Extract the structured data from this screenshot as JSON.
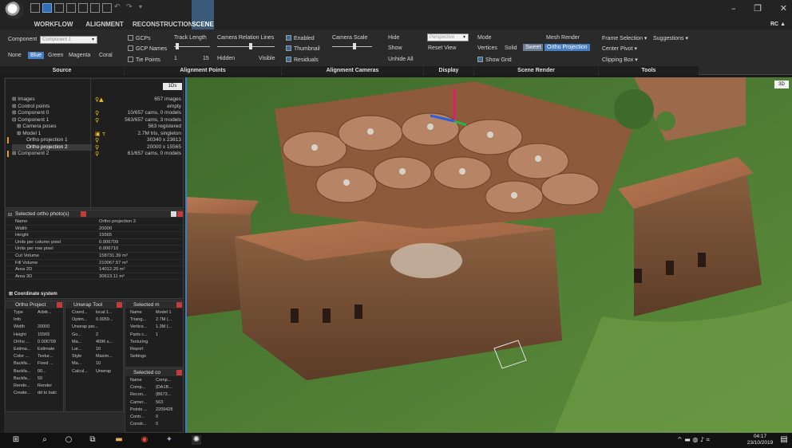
{
  "tabs": [
    "WORKFLOW",
    "ALIGNMENT",
    "RECONSTRUCTION",
    "SCENE"
  ],
  "titlebar": {
    "right_label": "RC"
  },
  "ribbon": {
    "component_label": "Component",
    "component_value": "Component 1",
    "colors": [
      "None",
      "Blue",
      "Green",
      "Magenta",
      "Coral"
    ],
    "gcps": "GCPs",
    "gcp_names": "GCP Names",
    "tie_points": "Tie Points",
    "track_length": "Track Length",
    "track_min": "1",
    "track_max": "15",
    "camera_relation": "Camera Relation Lines",
    "hidden": "Hidden",
    "visible": "Visible",
    "enabled": "Enabled",
    "thumbnail": "Thumbnail",
    "residuals": "Residuals",
    "camera_scale": "Camera Scale",
    "hide": "Hide",
    "show": "Show",
    "unhide_all": "Unhide All",
    "perspective": "Perspective",
    "reset_view": "Reset View",
    "mode": "Mode",
    "vertices": "Vertices",
    "solid": "Solid",
    "sweet": "Sweet",
    "mesh_render": "Mesh Render",
    "ortho_projection": "Ortho Projection",
    "show_grid": "Show Grid",
    "frame_selection": "Frame Selection",
    "suggestions": "Suggestions",
    "center_pivot": "Center Pivot",
    "clipping_box": "Clipping Box",
    "groups": [
      "Source",
      "Alignment Points",
      "Alignment Cameras",
      "Display",
      "Scene Render",
      "Tools"
    ]
  },
  "tree": {
    "badge": "1Ds",
    "rows": [
      {
        "name": "Images",
        "value": "657 images"
      },
      {
        "name": "Control points",
        "value": "empty"
      },
      {
        "name": "Component 0",
        "value": "10/657 cams, 0 models"
      },
      {
        "name": "Component 1",
        "value": "563/657 cams, 3 models"
      },
      {
        "name": "Camera poses",
        "value": "563 registered"
      },
      {
        "name": "Model 1",
        "value": "2.7M tris, singleton"
      },
      {
        "name": "Ortho projection 1",
        "value": "30340 x 23613"
      },
      {
        "name": "Ortho projection 2",
        "value": "20000 x 15565"
      },
      {
        "name": "Component 2",
        "value": "61/657 cams, 0 models"
      }
    ]
  },
  "ortho_panel": {
    "title": "Selected ortho photo(s)",
    "rows": [
      {
        "k": "Name",
        "v": "Ortho projection 2"
      },
      {
        "k": "Width",
        "v": "20000"
      },
      {
        "k": "Height",
        "v": "15565"
      },
      {
        "k": "Units per column pixel",
        "v": "0.006709"
      },
      {
        "k": "Units per row pixel",
        "v": "0.006710"
      },
      {
        "k": "Cut Volume",
        "v": "158731.39 m³"
      },
      {
        "k": "Fill Volume",
        "v": "210067.57 m³"
      },
      {
        "k": "Area 2D",
        "v": "14012.20 m²"
      },
      {
        "k": "Area 3D",
        "v": "30613.11 m²"
      }
    ],
    "footer": "Coordinate system"
  },
  "mini_ortho": {
    "title": "Ortho Project",
    "rows": [
      {
        "k": "Type",
        "v": "Arbitr..."
      },
      {
        "k": "Info",
        "v": ""
      },
      {
        "k": "Width",
        "v": "20000"
      },
      {
        "k": "Height",
        "v": "15565"
      },
      {
        "k": "Ortho ...",
        "v": "0.006709"
      },
      {
        "k": "Estima...",
        "v": "Estimate"
      },
      {
        "k": "Color ...",
        "v": "Textur..."
      },
      {
        "k": "Backfa...",
        "v": "Fixed ..."
      },
      {
        "k": "Backfa...",
        "v": "00..."
      },
      {
        "k": "Backfa...",
        "v": "50"
      },
      {
        "k": "Rende...",
        "v": "Render"
      },
      {
        "k": "Create...",
        "v": "dd to batc"
      }
    ]
  },
  "mini_unwrap": {
    "title": "Unwrap Tool",
    "rows": [
      {
        "k": "Coord...",
        "v": "local:1..."
      },
      {
        "k": "Optim...",
        "v": "0.0059..."
      },
      {
        "k": "Unwrap par...",
        "v": ""
      },
      {
        "k": "Go...",
        "v": "2"
      },
      {
        "k": "Ma...",
        "v": "4096 s..."
      },
      {
        "k": "Lar...",
        "v": "10"
      },
      {
        "k": "Style",
        "v": "Maxim..."
      },
      {
        "k": "Ma...",
        "v": "10"
      },
      {
        "k": "Calcul...",
        "v": "Unwrap"
      }
    ]
  },
  "mini_model": {
    "title": "Selected m",
    "rows": [
      {
        "k": "Name",
        "v": "Model 1"
      },
      {
        "k": "Triang...",
        "v": "2.7M (..."
      },
      {
        "k": "Vertice...",
        "v": "1.3M (..."
      },
      {
        "k": "Parts c...",
        "v": "1"
      },
      {
        "k": "Texturing",
        "v": ""
      },
      {
        "k": "Report",
        "v": ""
      },
      {
        "k": "Settings",
        "v": ""
      }
    ]
  },
  "mini_comp": {
    "title": "Selected co",
    "rows": [
      {
        "k": "Name",
        "v": "Comp..."
      },
      {
        "k": "Comp...",
        "v": "{DA1B..."
      },
      {
        "k": "Recon...",
        "v": "{B673..."
      },
      {
        "k": "Camer...",
        "v": "563"
      },
      {
        "k": "Points ...",
        "v": "2209428"
      },
      {
        "k": "Contr...",
        "v": "0"
      },
      {
        "k": "Constr...",
        "v": "0"
      }
    ]
  },
  "viewport": {
    "badge": "3D"
  },
  "taskbar": {
    "time": "04:17",
    "date": "23/10/2019"
  },
  "colors": {
    "accent": "#3a80c8",
    "selected": "#4a7ec2",
    "ribbon": "#2a2a2a"
  }
}
